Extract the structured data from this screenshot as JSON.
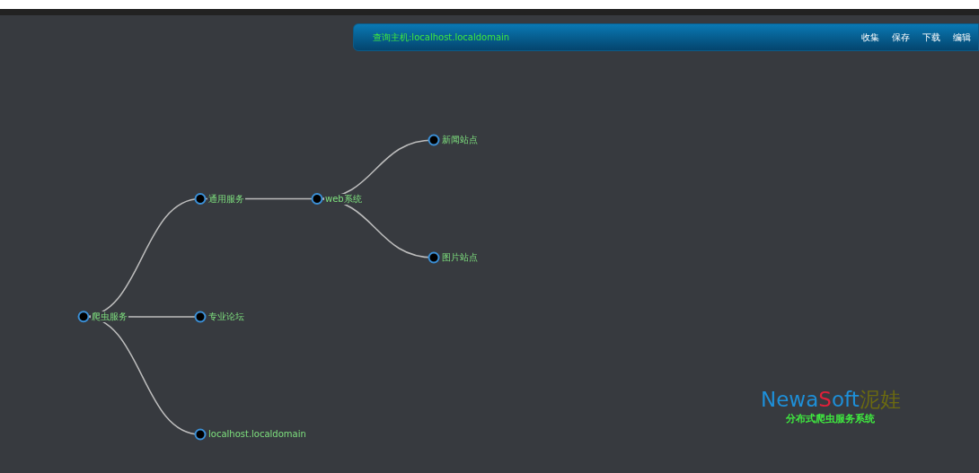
{
  "header": {
    "title": "查询主机:localhost.localdomain",
    "actions": [
      "收集",
      "保存",
      "下载",
      "编辑"
    ]
  },
  "tree": {
    "label": "爬虫服务",
    "children": [
      {
        "label": "通用服务",
        "children": [
          {
            "label": "web系统",
            "children": [
              {
                "label": "新闻站点"
              },
              {
                "label": "图片站点"
              }
            ]
          }
        ]
      },
      {
        "label": "专业论坛"
      },
      {
        "label": "localhost.localdomain"
      }
    ]
  },
  "logo": {
    "parts": [
      {
        "text": "Newa",
        "color": "#1e8fd8"
      },
      {
        "text": "S",
        "color": "#e0203a"
      },
      {
        "text": "oft",
        "color": "#1e8fd8"
      },
      {
        "text": "泥娃",
        "color": "#6b6a10"
      }
    ],
    "subtitle": "分布式爬虫服务系统"
  }
}
